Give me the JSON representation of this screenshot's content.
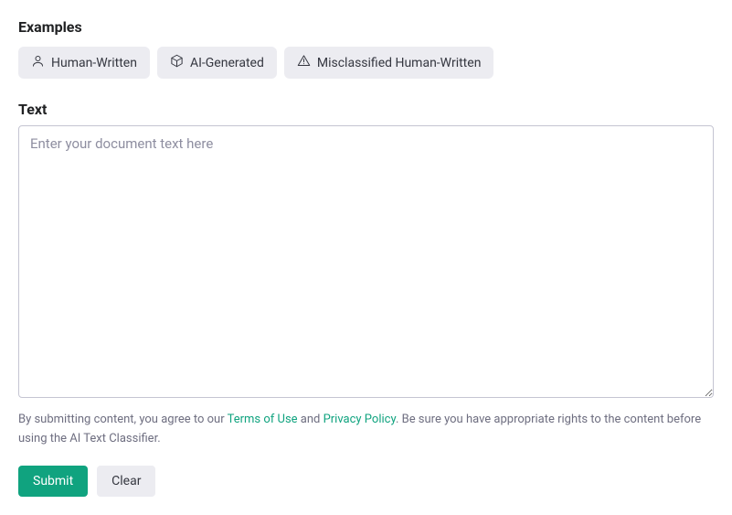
{
  "examples": {
    "heading": "Examples",
    "chips": {
      "human": "Human-Written",
      "ai": "AI-Generated",
      "misclassified": "Misclassified Human-Written"
    }
  },
  "text": {
    "label": "Text",
    "placeholder": "Enter your document text here",
    "value": ""
  },
  "disclaimer": {
    "prefix": "By submitting content, you agree to our ",
    "terms": "Terms of Use",
    "and": " and ",
    "privacy": "Privacy Policy",
    "suffix": ". Be sure you have appropriate rights to the content before using the AI Text Classifier."
  },
  "buttons": {
    "submit": "Submit",
    "clear": "Clear"
  }
}
